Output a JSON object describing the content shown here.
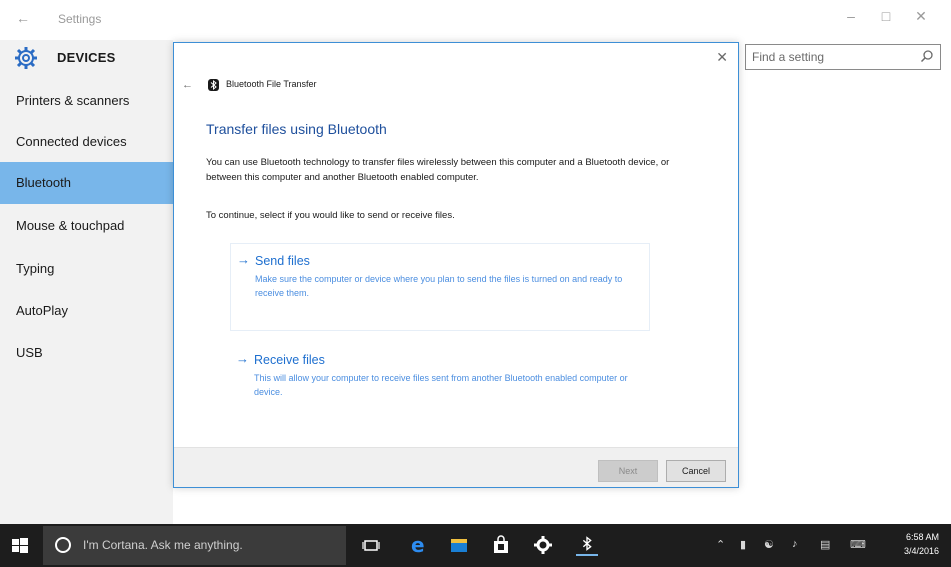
{
  "titlebar": {
    "back_icon": "back-arrow-icon",
    "title": "Settings",
    "controls": [
      "minimize-icon",
      "restore-icon",
      "close-icon"
    ]
  },
  "sidebar": {
    "section": "DEVICES",
    "section_icon": "gear-icon",
    "items": [
      {
        "label": "Printers & scanners",
        "active": false
      },
      {
        "label": "Connected devices",
        "active": false
      },
      {
        "label": "Bluetooth",
        "active": true
      },
      {
        "label": "Mouse & touchpad",
        "active": false
      },
      {
        "label": "Typing",
        "active": false
      },
      {
        "label": "AutoPlay",
        "active": false
      },
      {
        "label": "USB",
        "active": false
      }
    ]
  },
  "search": {
    "placeholder": "Find a setting",
    "icon": "search-icon"
  },
  "dialog": {
    "window_title": "Bluetooth File Transfer",
    "heading": "Transfer files using Bluetooth",
    "description": "You can use Bluetooth technology to transfer files wirelessly between this computer and a Bluetooth device, or between this computer and another Bluetooth enabled computer.",
    "prompt": "To continue, select if you would like to send or receive files.",
    "options": [
      {
        "title": "Send files",
        "description": "Make sure the computer or device where you plan to send the files is turned on and ready to receive them."
      },
      {
        "title": "Receive files",
        "description": "This will allow your computer to receive files sent from another Bluetooth enabled computer or device."
      }
    ],
    "buttons": {
      "next": "Next",
      "cancel": "Cancel"
    }
  },
  "taskbar": {
    "search_text": "I'm Cortana. Ask me anything.",
    "time": "6:58 AM",
    "date": "3/4/2016",
    "accent": "#78b6ea"
  }
}
